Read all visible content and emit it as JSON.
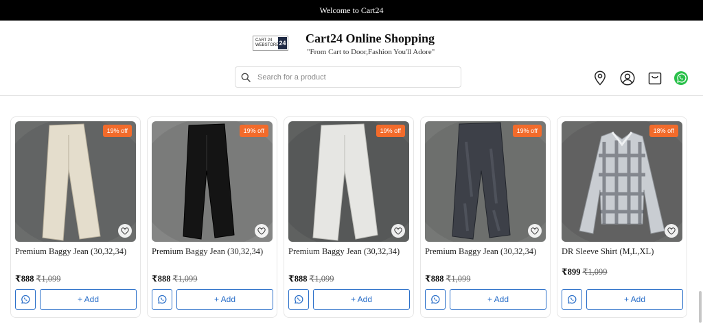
{
  "topbar": {
    "text": "Welcome to Cart24"
  },
  "header": {
    "logo": {
      "text": "CART 24 WEBSTORE",
      "mark": "24"
    },
    "title": "Cart24 Online Shopping",
    "tagline": "\"From Cart to Door,Fashion You'll Adore\"",
    "search_placeholder": "Search for a product",
    "icons": [
      "location-icon",
      "user-icon",
      "cart-icon",
      "whatsapp-icon"
    ]
  },
  "products": [
    {
      "name": "Premium Baggy Jean (30,32,34)",
      "discount": "19% off",
      "price": "₹888",
      "mrp": "₹1,099",
      "add_label": "+ Add",
      "color": "#e4ddcc"
    },
    {
      "name": "Premium Baggy Jean (30,32,34)",
      "discount": "19% off",
      "price": "₹888",
      "mrp": "₹1,099",
      "add_label": "+ Add",
      "color": "#141414"
    },
    {
      "name": "Premium Baggy Jean (30,32,34)",
      "discount": "19% off",
      "price": "₹888",
      "mrp": "₹1,099",
      "add_label": "+ Add",
      "color": "#e6e6e3"
    },
    {
      "name": "Premium Baggy Jean (30,32,34)",
      "discount": "19% off",
      "price": "₹888",
      "mrp": "₹1,099",
      "add_label": "+ Add",
      "color": "#3d4048"
    },
    {
      "name": "DR Sleeve Shirt (M,L,XL)",
      "discount": "18% off",
      "price": "₹899",
      "mrp": "₹1,099",
      "add_label": "+ Add",
      "color": "#c9cdd2"
    }
  ],
  "colors": {
    "accent": "#2a6fc9",
    "badge": "#f26b2b",
    "topbar": "#000000"
  }
}
